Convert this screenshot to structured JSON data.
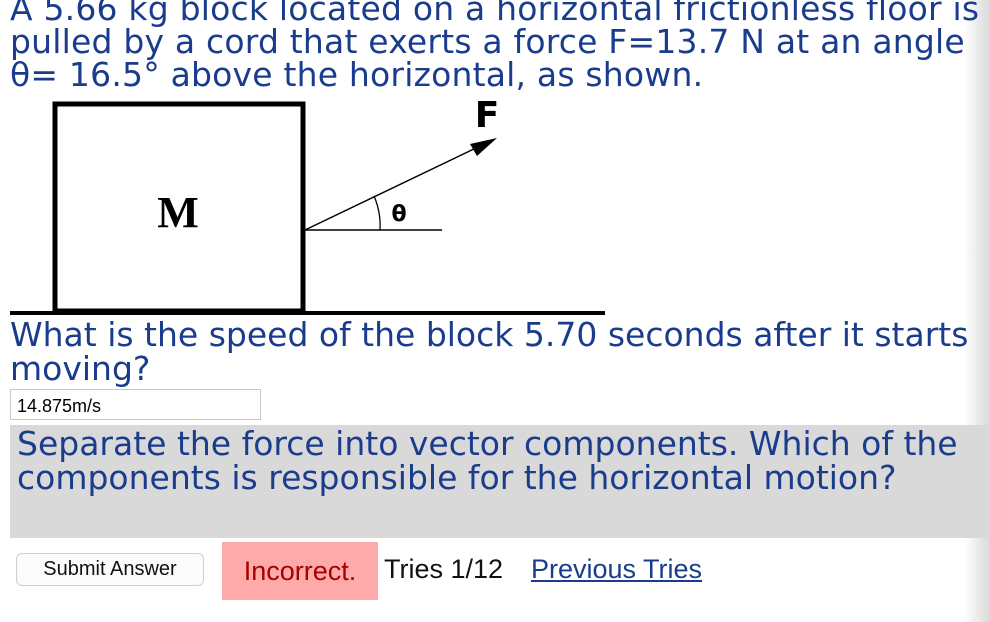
{
  "problem": {
    "text": "A 5.66 kg block located on a horizontal frictionless floor is pulled by a cord that exerts a force F=13.7 N at an angle θ= 16.5° above the horizontal, as shown."
  },
  "diagram": {
    "block_label": "M",
    "force_label": "F",
    "angle_label": "θ"
  },
  "question": {
    "text": "What is the speed of the block 5.70 seconds after it starts moving?"
  },
  "answer": {
    "value": "14.875m/s"
  },
  "hint": {
    "text": "Separate the force into vector components. Which of the components is responsible for the horizontal motion?"
  },
  "controls": {
    "submit_label": "Submit Answer",
    "status": "Incorrect.",
    "tries": "Tries 1/12",
    "previous_tries_label": "Previous Tries"
  },
  "colors": {
    "text_blue": "#1a3c8c",
    "hint_background": "#d9d9d9",
    "incorrect_background": "#ffaaaa",
    "incorrect_text": "#a80000"
  }
}
